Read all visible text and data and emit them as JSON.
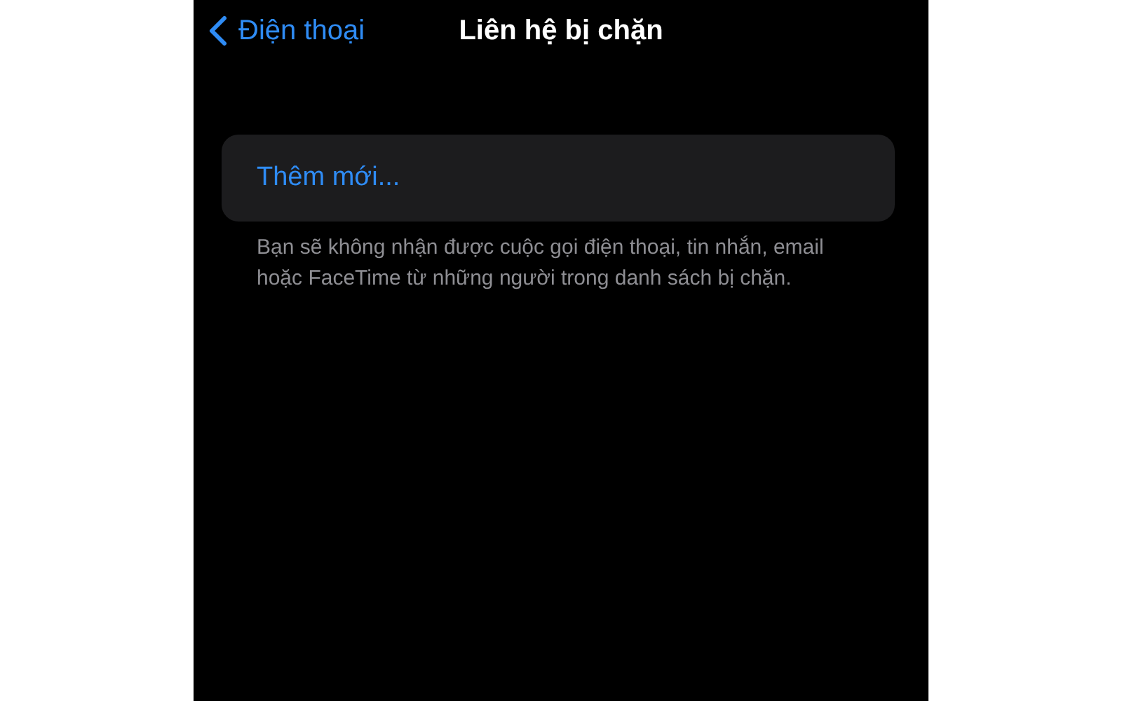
{
  "nav_bar": {
    "back_label": "Điện thoại",
    "title": "Liên hệ bị chặn"
  },
  "add_button": {
    "label": "Thêm mới..."
  },
  "footer_note": "Bạn sẽ không nhận được cuộc gọi điện thoại, tin nhắn, email hoặc FaceTime từ những người trong danh sách bị chặn."
}
